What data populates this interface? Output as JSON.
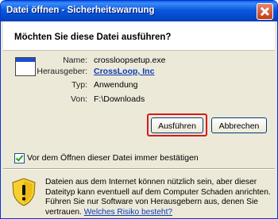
{
  "window": {
    "title": "Datei öffnen - Sicherheitswarnung"
  },
  "header": {
    "question": "Möchten Sie diese Datei ausführen?"
  },
  "details": [
    {
      "label": "Name:",
      "value": "crossloopsetup.exe"
    },
    {
      "label": "Herausgeber:",
      "value": "CrossLoop, Inc"
    },
    {
      "label": "Typ:",
      "value": "Anwendung"
    },
    {
      "label": "Von:",
      "value": "F:\\Downloads"
    }
  ],
  "buttons": {
    "run": "Ausführen",
    "cancel": "Abbrechen"
  },
  "checkbox": {
    "label": "Vor dem Öffnen dieser Datei immer bestätigen",
    "checked": true
  },
  "warning": {
    "text": "Dateien aus dem Internet können nützlich sein, aber dieser Dateityp kann eventuell auf dem Computer Schaden anrichten. Führen Sie nur Software von Herausgebern aus, denen Sie vertrauen.",
    "link": "Welches Risiko besteht?"
  },
  "colors": {
    "focus_highlight": "#d61a1a",
    "link": "#0b3bb3",
    "title_bar": "#0a58dc"
  }
}
